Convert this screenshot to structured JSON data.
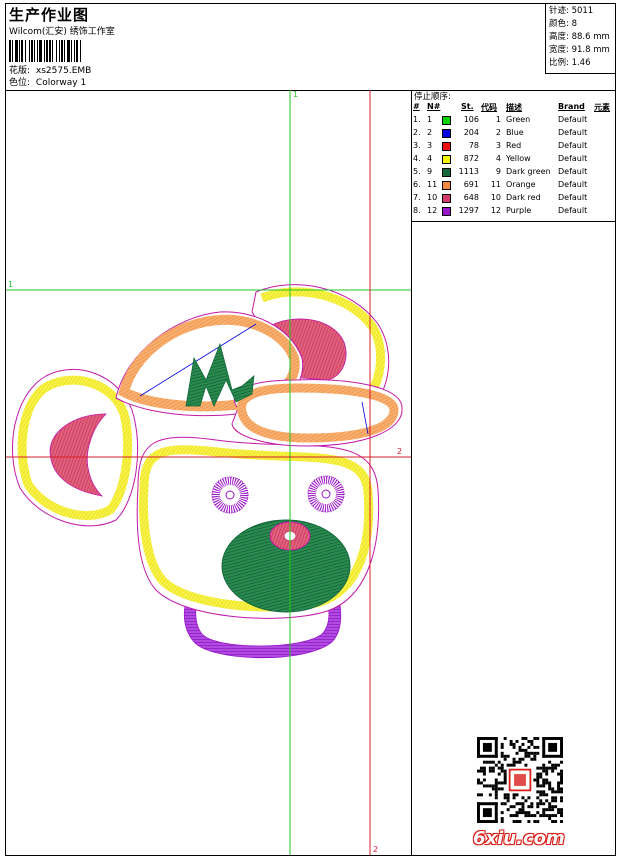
{
  "header": {
    "title": "生产作业图",
    "subtitle": "Wilcom(汇安) 绣饰工作室",
    "design_label": "花版:",
    "design_value": "xs2575.EMB",
    "colorway_label": "色位:",
    "colorway_value": "Colorway 1"
  },
  "stats": {
    "stitches": "针迹: 5011",
    "colors": "颜色: 8",
    "height": "高度: 88.6 mm",
    "width": "宽度: 91.8 mm",
    "ratio": "比例: 1.46"
  },
  "stop_sequence": {
    "title": "停止顺序:",
    "headers": {
      "num": "#",
      "n": "N#",
      "st": "St.",
      "code": "代码",
      "desc": "描述",
      "brand": "Brand",
      "element": "元素"
    },
    "rows": [
      {
        "num": "1.",
        "n": "1",
        "color": "#00d400",
        "st": "106",
        "code": "1",
        "desc": "Green",
        "brand": "Default"
      },
      {
        "num": "2.",
        "n": "2",
        "color": "#0000e0",
        "st": "204",
        "code": "2",
        "desc": "Blue",
        "brand": "Default"
      },
      {
        "num": "3.",
        "n": "3",
        "color": "#ee1111",
        "st": "78",
        "code": "3",
        "desc": "Red",
        "brand": "Default"
      },
      {
        "num": "4.",
        "n": "4",
        "color": "#f4f400",
        "st": "872",
        "code": "4",
        "desc": "Yellow",
        "brand": "Default"
      },
      {
        "num": "5.",
        "n": "9",
        "color": "#126a3a",
        "st": "1113",
        "code": "9",
        "desc": "Dark green",
        "brand": "Default"
      },
      {
        "num": "6.",
        "n": "11",
        "color": "#f08a3c",
        "st": "691",
        "code": "11",
        "desc": "Orange",
        "brand": "Default"
      },
      {
        "num": "7.",
        "n": "10",
        "color": "#d23c6a",
        "st": "648",
        "code": "10",
        "desc": "Dark red",
        "brand": "Default"
      },
      {
        "num": "8.",
        "n": "12",
        "color": "#9a16c8",
        "st": "1297",
        "code": "12",
        "desc": "Purple",
        "brand": "Default"
      }
    ]
  },
  "guides": {
    "v1_label": "1",
    "h1_label": "1",
    "h2_label": "2",
    "v2_label": "2"
  },
  "watermark": "6xiu.com",
  "colors": {
    "guide_green": "#22c622",
    "guide_red": "#d81c2c",
    "outline": "#c21aa8"
  }
}
